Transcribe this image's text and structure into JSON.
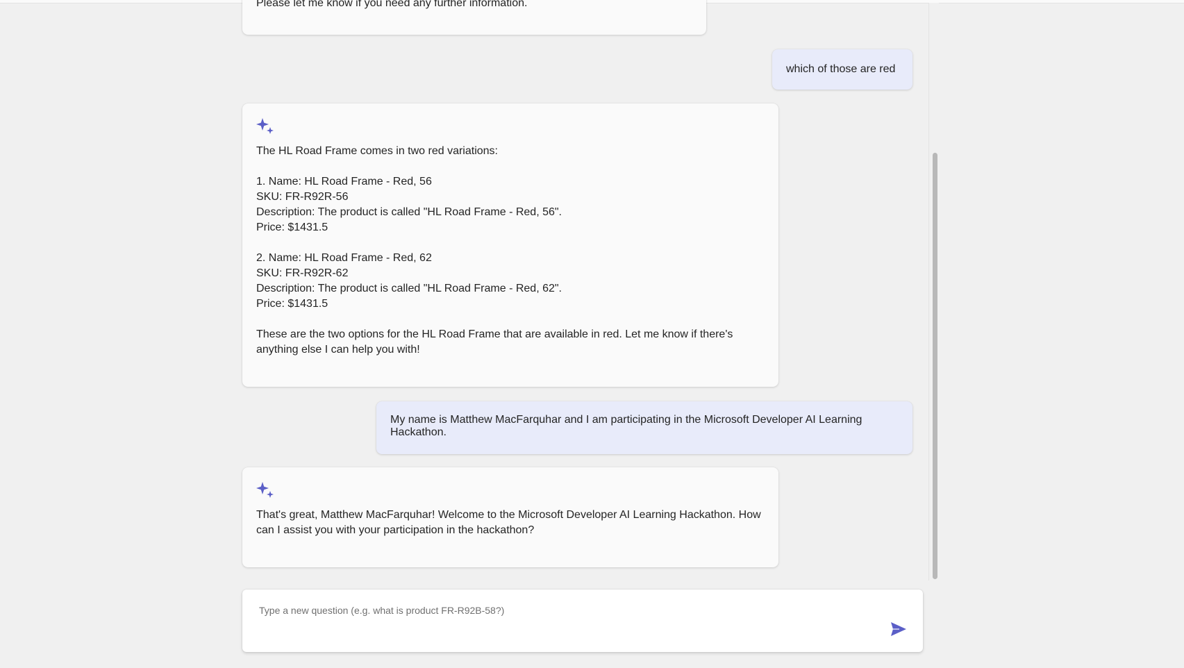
{
  "colors": {
    "accent": "#5b5fc7",
    "user_bubble": "#e8ebfa",
    "assistant_bubble": "#fafafa",
    "background": "#f0f0f0"
  },
  "messages": [
    {
      "role": "assistant",
      "lines": [
        "Please let me know if you need any further information."
      ]
    },
    {
      "role": "user",
      "text": "which of those are red"
    },
    {
      "role": "assistant",
      "icon": "sparkle-icon",
      "paragraphs": [
        [
          "The HL Road Frame comes in two red variations:"
        ],
        [
          "1. Name: HL Road Frame - Red, 56",
          "SKU: FR-R92R-56",
          "Description: The product is called \"HL Road Frame - Red, 56\".",
          "Price: $1431.5"
        ],
        [
          "2. Name: HL Road Frame - Red, 62",
          "SKU: FR-R92R-62",
          "Description: The product is called \"HL Road Frame - Red, 62\".",
          "Price: $1431.5"
        ],
        [
          "These are the two options for the HL Road Frame that are available in red. Let me know if there's anything else I can help you with!"
        ]
      ]
    },
    {
      "role": "user",
      "text": "My name is Matthew MacFarquhar and I am participating in the Microsoft Developer AI Learning Hackathon."
    },
    {
      "role": "assistant",
      "icon": "sparkle-icon",
      "paragraphs": [
        [
          "That's great, Matthew MacFarquhar! Welcome to the Microsoft Developer AI Learning Hackathon. How can I assist you with your participation in the hackathon?"
        ]
      ]
    }
  ],
  "composer": {
    "placeholder": "Type a new question (e.g. what is product FR-R92B-58?)",
    "value": "",
    "send_icon": "send-icon"
  }
}
